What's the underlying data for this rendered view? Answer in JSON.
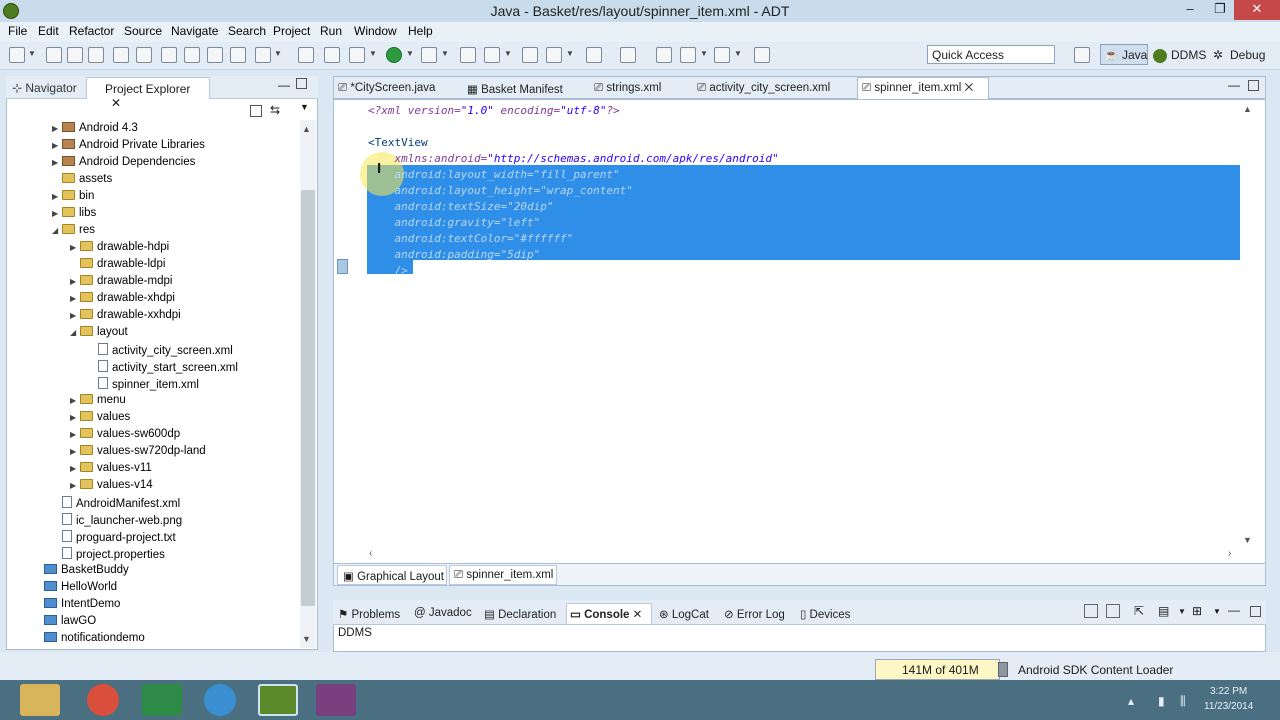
{
  "window": {
    "title": "Java - Basket/res/layout/spinner_item.xml - ADT"
  },
  "menu": [
    "File",
    "Edit",
    "Refactor",
    "Source",
    "Navigate",
    "Search",
    "Project",
    "Run",
    "Window",
    "Help"
  ],
  "toolbar": {
    "quick_access_placeholder": "Quick Access",
    "perspectives": [
      "Java",
      "DDMS",
      "Debug"
    ]
  },
  "left_panel": {
    "tabs": [
      "Navigator",
      "Project Explorer"
    ],
    "tree": [
      {
        "label": "Android 4.3",
        "indent": 1,
        "icon": "lib",
        "expander": "▶"
      },
      {
        "label": "Android Private Libraries",
        "indent": 1,
        "icon": "lib",
        "expander": "▶"
      },
      {
        "label": "Android Dependencies",
        "indent": 1,
        "icon": "lib",
        "expander": "▶"
      },
      {
        "label": "assets",
        "indent": 1,
        "icon": "folder",
        "expander": ""
      },
      {
        "label": "bin",
        "indent": 1,
        "icon": "folder",
        "expander": "▶"
      },
      {
        "label": "libs",
        "indent": 1,
        "icon": "folder",
        "expander": "▶"
      },
      {
        "label": "res",
        "indent": 1,
        "icon": "folder",
        "expander": "◢"
      },
      {
        "label": "drawable-hdpi",
        "indent": 2,
        "icon": "folder",
        "expander": "▶"
      },
      {
        "label": "drawable-ldpi",
        "indent": 2,
        "icon": "folder",
        "expander": ""
      },
      {
        "label": "drawable-mdpi",
        "indent": 2,
        "icon": "folder",
        "expander": "▶"
      },
      {
        "label": "drawable-xhdpi",
        "indent": 2,
        "icon": "folder",
        "expander": "▶"
      },
      {
        "label": "drawable-xxhdpi",
        "indent": 2,
        "icon": "folder",
        "expander": "▶"
      },
      {
        "label": "layout",
        "indent": 2,
        "icon": "folder",
        "expander": "◢"
      },
      {
        "label": "activity_city_screen.xml",
        "indent": 3,
        "icon": "file",
        "expander": ""
      },
      {
        "label": "activity_start_screen.xml",
        "indent": 3,
        "icon": "file",
        "expander": ""
      },
      {
        "label": "spinner_item.xml",
        "indent": 3,
        "icon": "file",
        "expander": ""
      },
      {
        "label": "menu",
        "indent": 2,
        "icon": "folder",
        "expander": "▶"
      },
      {
        "label": "values",
        "indent": 2,
        "icon": "folder",
        "expander": "▶"
      },
      {
        "label": "values-sw600dp",
        "indent": 2,
        "icon": "folder",
        "expander": "▶"
      },
      {
        "label": "values-sw720dp-land",
        "indent": 2,
        "icon": "folder",
        "expander": "▶"
      },
      {
        "label": "values-v11",
        "indent": 2,
        "icon": "folder",
        "expander": "▶"
      },
      {
        "label": "values-v14",
        "indent": 2,
        "icon": "folder",
        "expander": "▶"
      },
      {
        "label": "AndroidManifest.xml",
        "indent": 1,
        "icon": "file",
        "expander": ""
      },
      {
        "label": "ic_launcher-web.png",
        "indent": 1,
        "icon": "file",
        "expander": ""
      },
      {
        "label": "proguard-project.txt",
        "indent": 1,
        "icon": "file",
        "expander": ""
      },
      {
        "label": "project.properties",
        "indent": 1,
        "icon": "file",
        "expander": ""
      },
      {
        "label": "BasketBuddy",
        "indent": 0,
        "icon": "project",
        "expander": ""
      },
      {
        "label": "HelloWorld",
        "indent": 0,
        "icon": "project",
        "expander": ""
      },
      {
        "label": "IntentDemo",
        "indent": 0,
        "icon": "project",
        "expander": ""
      },
      {
        "label": "lawGO",
        "indent": 0,
        "icon": "project",
        "expander": ""
      },
      {
        "label": "notificationdemo",
        "indent": 0,
        "icon": "project",
        "expander": ""
      }
    ]
  },
  "editor": {
    "tabs": [
      "*CityScreen.java",
      "Basket Manifest",
      "strings.xml",
      "activity_city_screen.xml",
      "spinner_item.xml"
    ],
    "active_tab": "spinner_item.xml",
    "lines": [
      {
        "attr": "<?xml version=",
        "val": "\"1.0\"",
        "rest": " encoding=",
        "val2": "\"utf-8\"",
        "end": "?>"
      },
      {
        "text": "<TextView"
      },
      {
        "attr": "    xmlns:android=",
        "val": "\"http://schemas.android.com/apk/res/android\""
      },
      {
        "attr": "    android:layout_width=",
        "val": "\"fill_parent\""
      },
      {
        "attr": "    android:layout_height=",
        "val": "\"wrap_content\""
      },
      {
        "attr": "    android:textSize=",
        "val": "\"20dip\""
      },
      {
        "attr": "    android:gravity=",
        "val": "\"left\""
      },
      {
        "attr": "    android:textColor=",
        "val": "\"#ffffff\""
      },
      {
        "attr": "    android:padding=",
        "val": "\"5dip\""
      },
      {
        "text": "    />"
      }
    ],
    "bottom_tabs": [
      "Graphical Layout",
      "spinner_item.xml"
    ]
  },
  "console": {
    "tabs": [
      "Problems",
      "Javadoc",
      "Declaration",
      "Console",
      "LogCat",
      "Error Log",
      "Devices"
    ],
    "active_tab": "Console",
    "content": "DDMS"
  },
  "status": {
    "heap": "141M of 401M",
    "task": "Android SDK Content Loader"
  },
  "taskbar": {
    "time": "3:22 PM",
    "date": "11/23/2014"
  }
}
